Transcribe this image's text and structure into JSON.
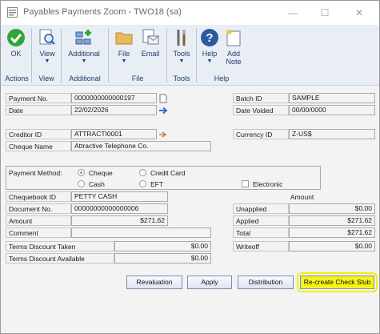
{
  "window": {
    "title": "Payables Payments Zoom  -  TWO18 (sa)",
    "min_label": "—",
    "max_label": "☐",
    "close_label": "✕"
  },
  "ribbon": {
    "buttons": [
      {
        "label": "OK",
        "icon": "check-icon"
      },
      {
        "label": "View",
        "icon": "view-icon"
      },
      {
        "label": "Additional",
        "icon": "additional-icon"
      },
      {
        "label": "File",
        "icon": "folder-icon"
      },
      {
        "label": "Email",
        "icon": "email-icon"
      },
      {
        "label": "Tools",
        "icon": "tools-icon"
      },
      {
        "label": "Help",
        "icon": "help-icon"
      },
      {
        "label": "Add\nNote",
        "icon": "note-icon"
      }
    ],
    "groups": [
      "Actions",
      "View",
      "Additional",
      "File",
      "Tools",
      "Help"
    ]
  },
  "form": {
    "payment_no_label": "Payment No.",
    "payment_no": "0000000000000197",
    "date_label": "Date",
    "date": "22/02/2026",
    "batch_id_label": "Batch ID",
    "batch_id": "SAMPLE",
    "date_voided_label": "Date Voided",
    "date_voided": "00/00/0000",
    "creditor_id_label": "Creditor ID",
    "creditor_id": "ATTRACTI0001",
    "cheque_name_label": "Cheque Name",
    "cheque_name": "Attractive Telephone Co.",
    "currency_id_label": "Currency ID",
    "currency_id": "Z-US$",
    "payment_method_label": "Payment Method:",
    "method_cheque": "Cheque",
    "method_cash": "Cash",
    "method_credit_card": "Credit Card",
    "method_eft": "EFT",
    "method_electronic": "Electronic",
    "chequebook_id_label": "Chequebook ID",
    "chequebook_id": "PETTY CASH",
    "document_no_label": "Document No.",
    "document_no": "00000000000000006",
    "amount_label": "Amount",
    "amount": "$271.62",
    "comment_label": "Comment",
    "amount_header": "Amount",
    "unapplied_label": "Unapplied",
    "unapplied": "$0.00",
    "applied_label": "Applied",
    "applied": "$271.62",
    "total_label": "Total",
    "total": "$271.62",
    "terms_taken_label": "Terms Discount Taken",
    "terms_taken": "$0.00",
    "terms_available_label": "Terms Discount Available",
    "terms_available": "$0.00",
    "writeoff_label": "Writeoff",
    "writeoff": "$0.00"
  },
  "buttons": {
    "revaluation": "Revaluation",
    "apply": "Apply",
    "distribution": "Distribution",
    "recreate": "Re-create Check Stub"
  },
  "colors": {
    "highlight": "#f6f31a",
    "ribbon_bg": "#e9eef5",
    "accent": "#1f3c6e"
  }
}
